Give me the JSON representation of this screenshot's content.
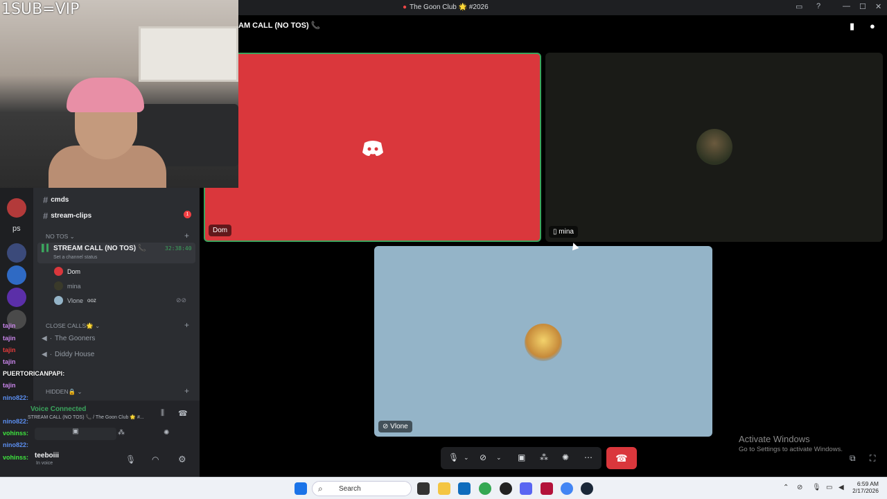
{
  "window": {
    "title": "The Goon Club 🌟 #2026"
  },
  "webcam": {
    "overlay_text": "1SUB=VIP"
  },
  "call": {
    "channel_name": "AM CALL (NO TOS) 📞"
  },
  "tiles": [
    {
      "name": "Dom",
      "color": "#da373c"
    },
    {
      "name": "mina",
      "color": "#1a1b17"
    },
    {
      "name": "Vlone",
      "color": "#94b4c8"
    }
  ],
  "sidebar": {
    "channels_top": [
      {
        "label": "cmds"
      },
      {
        "label": "stream-clips",
        "badge": "1"
      }
    ],
    "category_no_tos": "NO TOS",
    "voice_channel": {
      "label": "STREAM CALL (NO TOS) 📞",
      "timer": "32:38:40",
      "status": "Set a channel status"
    },
    "members": [
      {
        "name": "Dom"
      },
      {
        "name": "mina"
      },
      {
        "name": "Vlone",
        "extra": "ooz"
      }
    ],
    "category_close": "CLOSE CALLS🌟",
    "close_channels": [
      {
        "label": "The Gooners"
      },
      {
        "label": "Diddy House"
      }
    ],
    "category_hidden": "HIDDEN🔒",
    "ps_label": "ps",
    "voice_connected": "Voice Connected",
    "voice_connected_sub": "STREAM CALL (NO TOS) 📞 / The Goon Club 🌟 #...",
    "user": {
      "name": "teeboiii",
      "status": "In voice"
    }
  },
  "chat_overlay": [
    {
      "user": "tajin",
      "text": ""
    },
    {
      "user": "tajin",
      "text": ""
    },
    {
      "user": "tajin",
      "text": ""
    },
    {
      "user": "tajin",
      "text": ""
    },
    {
      "user": "PUERTORICANPAPI",
      "text": ":"
    },
    {
      "user": "tajin",
      "text": ""
    },
    {
      "user": "nino822",
      "text": ":"
    },
    {
      "user": "nino822",
      "text": ":"
    },
    {
      "user": "vohinss",
      "text": ":"
    },
    {
      "user": "nino822",
      "text": ":"
    },
    {
      "user": "vohinss",
      "text": ":"
    },
    {
      "user": "vohinss",
      "text": ":"
    }
  ],
  "activate": {
    "title": "Activate Windows",
    "sub": "Go to Settings to activate Windows."
  },
  "taskbar": {
    "search": "Search",
    "time": "6:59 AM",
    "date": "2/17/2026"
  }
}
